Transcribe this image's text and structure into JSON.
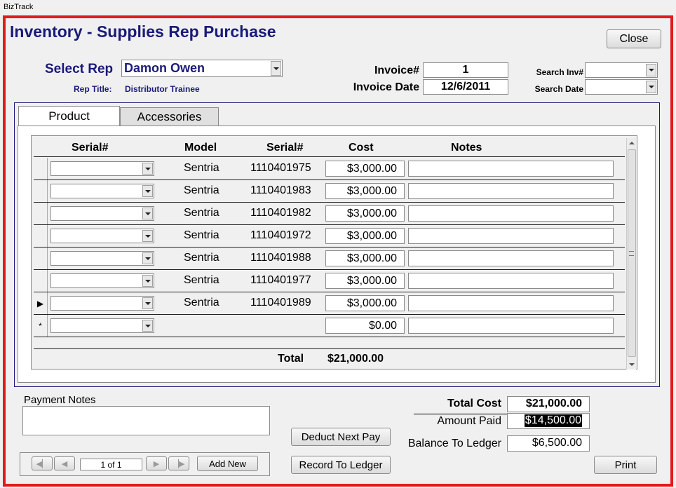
{
  "window": {
    "title": "BizTrack"
  },
  "form": {
    "title": "Inventory - Supplies Rep Purchase",
    "close_label": "Close",
    "select_rep_label": "Select Rep",
    "rep_value": "Damon Owen",
    "rep_title_label": "Rep Title:",
    "rep_title_value": "Distributor Trainee",
    "invoice_label": "Invoice#",
    "invoice_value": "1",
    "invoice_date_label": "Invoice Date",
    "invoice_date_value": "12/6/2011",
    "search_inv_label": "Search Inv#",
    "search_inv_value": "",
    "search_date_label": "Search Date",
    "search_date_value": ""
  },
  "tabs": [
    {
      "label": "Product",
      "active": true
    },
    {
      "label": "Accessories",
      "active": false
    }
  ],
  "grid": {
    "columns": [
      "Serial#",
      "Model",
      "Serial#",
      "Cost",
      "Notes"
    ],
    "rows": [
      {
        "serial_select": "",
        "model": "Sentria",
        "serial": "1110401975",
        "cost": "$3,000.00",
        "notes": "",
        "marker": ""
      },
      {
        "serial_select": "",
        "model": "Sentria",
        "serial": "1110401983",
        "cost": "$3,000.00",
        "notes": "",
        "marker": ""
      },
      {
        "serial_select": "",
        "model": "Sentria",
        "serial": "1110401982",
        "cost": "$3,000.00",
        "notes": "",
        "marker": ""
      },
      {
        "serial_select": "",
        "model": "Sentria",
        "serial": "1110401972",
        "cost": "$3,000.00",
        "notes": "",
        "marker": ""
      },
      {
        "serial_select": "",
        "model": "Sentria",
        "serial": "1110401988",
        "cost": "$3,000.00",
        "notes": "",
        "marker": ""
      },
      {
        "serial_select": "",
        "model": "Sentria",
        "serial": "1110401977",
        "cost": "$3,000.00",
        "notes": "",
        "marker": ""
      },
      {
        "serial_select": "",
        "model": "Sentria",
        "serial": "1110401989",
        "cost": "$3,000.00",
        "notes": "",
        "marker": "▶"
      },
      {
        "serial_select": "",
        "model": "",
        "serial": "",
        "cost": "$0.00",
        "notes": "",
        "marker": "*"
      }
    ],
    "total_label": "Total",
    "total_value": "$21,000.00"
  },
  "payment": {
    "notes_label": "Payment Notes",
    "notes_value": ""
  },
  "nav": {
    "record_text": "1 of 1",
    "add_new_label": "Add New",
    "first_icon": "first-record-icon",
    "prev_icon": "prev-record-icon",
    "next_icon": "next-record-icon",
    "last_icon": "last-record-icon"
  },
  "actions": {
    "deduct_label": "Deduct Next Pay",
    "record_ledger_label": "Record To Ledger",
    "print_label": "Print"
  },
  "summary": {
    "total_cost_label": "Total Cost",
    "total_cost_value": "$21,000.00",
    "amount_paid_label": "Amount Paid",
    "amount_paid_value": "$14,500.00",
    "balance_label": "Balance To Ledger",
    "balance_value": "$6,500.00"
  }
}
